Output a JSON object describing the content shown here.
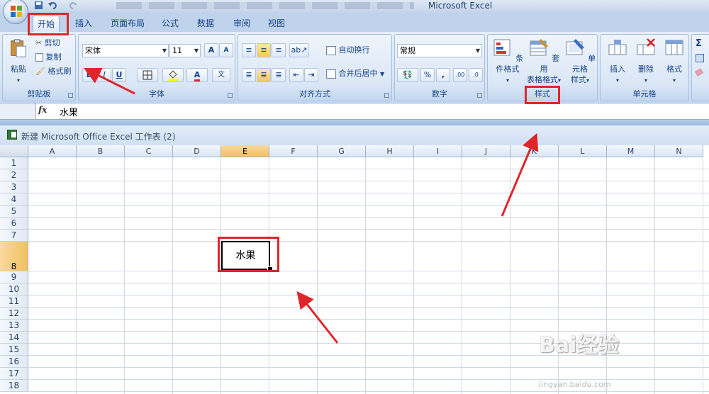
{
  "window": {
    "title": "Microsoft Excel"
  },
  "tabs": [
    "开始",
    "插入",
    "页面布局",
    "公式",
    "数据",
    "审阅",
    "视图"
  ],
  "ribbon": {
    "clipboard": {
      "label": "剪贴板",
      "paste": "粘贴",
      "cut": "剪切",
      "copy": "复制",
      "format_painter": "格式刷"
    },
    "font": {
      "label": "字体",
      "font_name": "宋体",
      "font_size": "11",
      "bold": "B",
      "italic": "I",
      "underline": "U",
      "grow": "A",
      "shrink": "A",
      "color_letter": "A",
      "phonetic": "文"
    },
    "alignment": {
      "label": "对齐方式",
      "wrap": "自动换行",
      "merge": "合并后居中"
    },
    "number": {
      "label": "数字",
      "format": "常规",
      "percent": "%",
      "comma": ",",
      "inc_dec": ".00",
      "dec_dec": ".0"
    },
    "styles": {
      "label": "样式",
      "conditional": "条件格式",
      "table_a": "套用",
      "table_b": "表格格式",
      "cell_a": "单元格",
      "cell_b": "样式"
    },
    "cells": {
      "label": "单元格",
      "insert": "插入",
      "delete": "删除",
      "format": "格式"
    },
    "editing": {
      "sigma": "Σ"
    }
  },
  "formula_bar": {
    "fx": "fx",
    "value": "水果"
  },
  "workbook": {
    "title": "新建 Microsoft Office Excel 工作表 (2)"
  },
  "grid": {
    "columns": [
      "A",
      "B",
      "C",
      "D",
      "E",
      "F",
      "G",
      "H",
      "I",
      "J",
      "K",
      "L",
      "M",
      "N"
    ],
    "rows": [
      "1",
      "2",
      "3",
      "4",
      "5",
      "6",
      "7",
      "8",
      "9",
      "10",
      "11",
      "12",
      "13",
      "14",
      "15",
      "16",
      "17",
      "18"
    ],
    "active_cell": {
      "ref": "E8",
      "value": "水果"
    }
  },
  "watermark": {
    "brand": "Bai经验",
    "url": "jingyan.baidu.com"
  }
}
